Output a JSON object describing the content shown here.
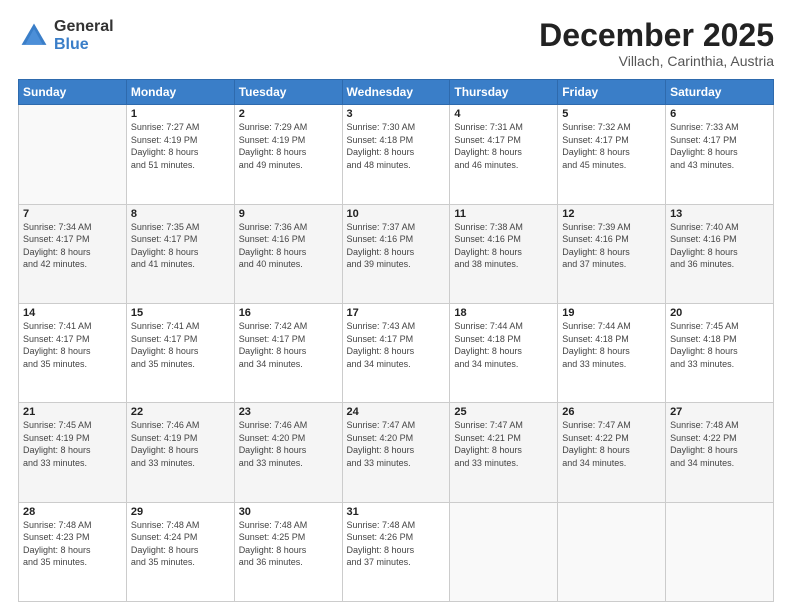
{
  "logo": {
    "general": "General",
    "blue": "Blue"
  },
  "header": {
    "month": "December 2025",
    "location": "Villach, Carinthia, Austria"
  },
  "days_of_week": [
    "Sunday",
    "Monday",
    "Tuesday",
    "Wednesday",
    "Thursday",
    "Friday",
    "Saturday"
  ],
  "weeks": [
    [
      {
        "day": "",
        "info": ""
      },
      {
        "day": "1",
        "info": "Sunrise: 7:27 AM\nSunset: 4:19 PM\nDaylight: 8 hours\nand 51 minutes."
      },
      {
        "day": "2",
        "info": "Sunrise: 7:29 AM\nSunset: 4:19 PM\nDaylight: 8 hours\nand 49 minutes."
      },
      {
        "day": "3",
        "info": "Sunrise: 7:30 AM\nSunset: 4:18 PM\nDaylight: 8 hours\nand 48 minutes."
      },
      {
        "day": "4",
        "info": "Sunrise: 7:31 AM\nSunset: 4:17 PM\nDaylight: 8 hours\nand 46 minutes."
      },
      {
        "day": "5",
        "info": "Sunrise: 7:32 AM\nSunset: 4:17 PM\nDaylight: 8 hours\nand 45 minutes."
      },
      {
        "day": "6",
        "info": "Sunrise: 7:33 AM\nSunset: 4:17 PM\nDaylight: 8 hours\nand 43 minutes."
      }
    ],
    [
      {
        "day": "7",
        "info": "Sunrise: 7:34 AM\nSunset: 4:17 PM\nDaylight: 8 hours\nand 42 minutes."
      },
      {
        "day": "8",
        "info": "Sunrise: 7:35 AM\nSunset: 4:17 PM\nDaylight: 8 hours\nand 41 minutes."
      },
      {
        "day": "9",
        "info": "Sunrise: 7:36 AM\nSunset: 4:16 PM\nDaylight: 8 hours\nand 40 minutes."
      },
      {
        "day": "10",
        "info": "Sunrise: 7:37 AM\nSunset: 4:16 PM\nDaylight: 8 hours\nand 39 minutes."
      },
      {
        "day": "11",
        "info": "Sunrise: 7:38 AM\nSunset: 4:16 PM\nDaylight: 8 hours\nand 38 minutes."
      },
      {
        "day": "12",
        "info": "Sunrise: 7:39 AM\nSunset: 4:16 PM\nDaylight: 8 hours\nand 37 minutes."
      },
      {
        "day": "13",
        "info": "Sunrise: 7:40 AM\nSunset: 4:16 PM\nDaylight: 8 hours\nand 36 minutes."
      }
    ],
    [
      {
        "day": "14",
        "info": "Sunrise: 7:41 AM\nSunset: 4:17 PM\nDaylight: 8 hours\nand 35 minutes."
      },
      {
        "day": "15",
        "info": "Sunrise: 7:41 AM\nSunset: 4:17 PM\nDaylight: 8 hours\nand 35 minutes."
      },
      {
        "day": "16",
        "info": "Sunrise: 7:42 AM\nSunset: 4:17 PM\nDaylight: 8 hours\nand 34 minutes."
      },
      {
        "day": "17",
        "info": "Sunrise: 7:43 AM\nSunset: 4:17 PM\nDaylight: 8 hours\nand 34 minutes."
      },
      {
        "day": "18",
        "info": "Sunrise: 7:44 AM\nSunset: 4:18 PM\nDaylight: 8 hours\nand 34 minutes."
      },
      {
        "day": "19",
        "info": "Sunrise: 7:44 AM\nSunset: 4:18 PM\nDaylight: 8 hours\nand 33 minutes."
      },
      {
        "day": "20",
        "info": "Sunrise: 7:45 AM\nSunset: 4:18 PM\nDaylight: 8 hours\nand 33 minutes."
      }
    ],
    [
      {
        "day": "21",
        "info": "Sunrise: 7:45 AM\nSunset: 4:19 PM\nDaylight: 8 hours\nand 33 minutes."
      },
      {
        "day": "22",
        "info": "Sunrise: 7:46 AM\nSunset: 4:19 PM\nDaylight: 8 hours\nand 33 minutes."
      },
      {
        "day": "23",
        "info": "Sunrise: 7:46 AM\nSunset: 4:20 PM\nDaylight: 8 hours\nand 33 minutes."
      },
      {
        "day": "24",
        "info": "Sunrise: 7:47 AM\nSunset: 4:20 PM\nDaylight: 8 hours\nand 33 minutes."
      },
      {
        "day": "25",
        "info": "Sunrise: 7:47 AM\nSunset: 4:21 PM\nDaylight: 8 hours\nand 33 minutes."
      },
      {
        "day": "26",
        "info": "Sunrise: 7:47 AM\nSunset: 4:22 PM\nDaylight: 8 hours\nand 34 minutes."
      },
      {
        "day": "27",
        "info": "Sunrise: 7:48 AM\nSunset: 4:22 PM\nDaylight: 8 hours\nand 34 minutes."
      }
    ],
    [
      {
        "day": "28",
        "info": "Sunrise: 7:48 AM\nSunset: 4:23 PM\nDaylight: 8 hours\nand 35 minutes."
      },
      {
        "day": "29",
        "info": "Sunrise: 7:48 AM\nSunset: 4:24 PM\nDaylight: 8 hours\nand 35 minutes."
      },
      {
        "day": "30",
        "info": "Sunrise: 7:48 AM\nSunset: 4:25 PM\nDaylight: 8 hours\nand 36 minutes."
      },
      {
        "day": "31",
        "info": "Sunrise: 7:48 AM\nSunset: 4:26 PM\nDaylight: 8 hours\nand 37 minutes."
      },
      {
        "day": "",
        "info": ""
      },
      {
        "day": "",
        "info": ""
      },
      {
        "day": "",
        "info": ""
      }
    ]
  ]
}
